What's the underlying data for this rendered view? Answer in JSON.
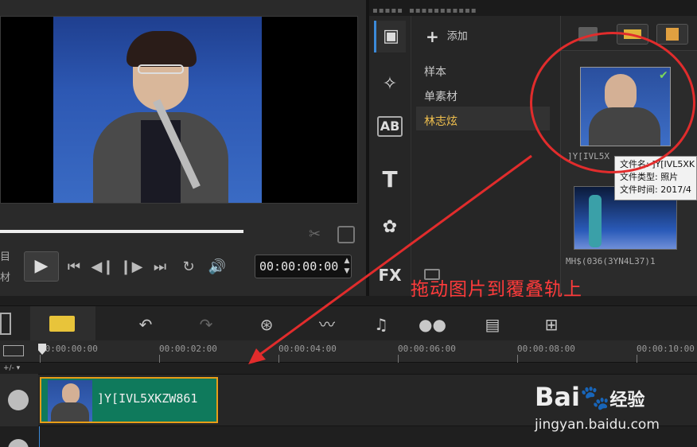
{
  "preview": {
    "timecode": "00:00:00:00",
    "side_labels": [
      "目",
      "材"
    ]
  },
  "library": {
    "add_label": "添加",
    "folders": [
      "样本",
      "单素材",
      "林志炫"
    ],
    "selected_folder_color": "#f2c14e",
    "icons": [
      "media-icon",
      "transition-icon",
      "title-ab-icon",
      "text-icon",
      "graphics-icon",
      "fx-icon"
    ],
    "fx_label": "FX",
    "ab_label": "AB"
  },
  "media": {
    "thumb1_caption": "]Y[IVL5X",
    "thumb2_caption": "MH$(036(3YN4L37)1",
    "tooltip": {
      "line1": "文件名: ]Y[IVL5XK",
      "line2": "文件类型: 照片",
      "line3": "文件时间: 2017/4"
    }
  },
  "annotation": {
    "instruction": "拖动图片到覆叠轨上",
    "color": "#e12c2c"
  },
  "timeline": {
    "ticks": [
      "00:00:00:00",
      "00:00:02:00",
      "00:00:04:00",
      "00:00:06:00",
      "00:00:08:00",
      "00:00:10:00"
    ],
    "zoom_label": "+/- ▾",
    "clip_label": "]Y[IVL5XKZW861",
    "clip_color": "#0f7a5c",
    "clip_border": "#e89d17"
  },
  "watermark": {
    "logo": "Bai",
    "logo_cn": "经验",
    "sub": "jingyan.baidu.com"
  }
}
